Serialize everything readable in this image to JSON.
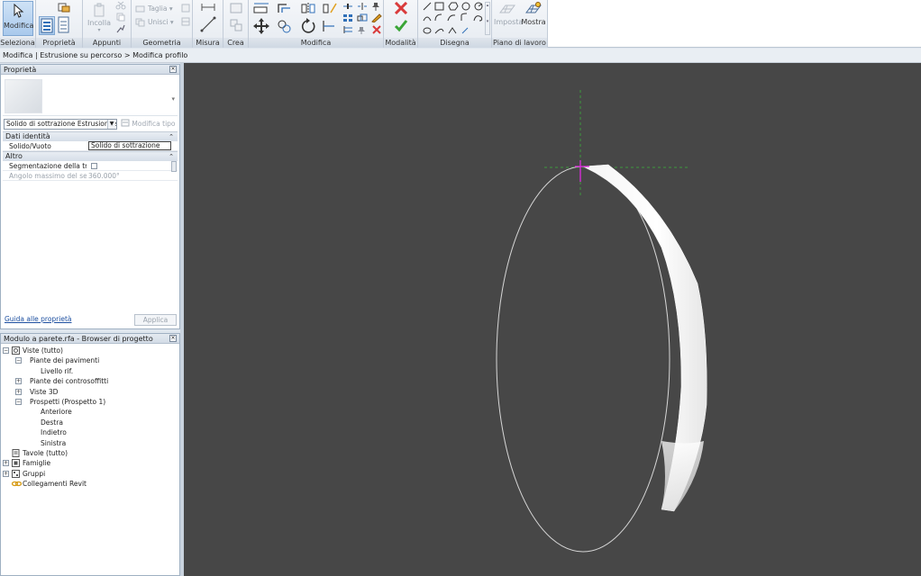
{
  "ribbon": {
    "panels": [
      {
        "id": "seleziona",
        "label": "Seleziona"
      },
      {
        "id": "proprieta",
        "label": "Proprietà"
      },
      {
        "id": "appunti",
        "label": "Appunti"
      },
      {
        "id": "geometria",
        "label": "Geometria"
      },
      {
        "id": "misura",
        "label": "Misura"
      },
      {
        "id": "crea",
        "label": "Crea"
      },
      {
        "id": "modifica",
        "label": "Modifica"
      },
      {
        "id": "modalita",
        "label": "Modalità"
      },
      {
        "id": "disegna",
        "label": "Disegna"
      },
      {
        "id": "piano",
        "label": "Piano di lavoro"
      }
    ],
    "buttons": {
      "modifica": "Modifica",
      "incolla": "Incolla",
      "taglia": "Taglia",
      "unisci": "Unisci",
      "imposta": "Imposta",
      "mostra": "Mostra"
    },
    "colors": {
      "finish": "#d93a3a",
      "ok": "#3aa536",
      "accent": "#2f6fb8"
    }
  },
  "breadcrumb": "Modifica | Estrusione su percorso > Modifica profilo",
  "properties": {
    "title": "Proprietà",
    "type_selector": "Solido di sottrazione Estrusione su",
    "edit_type": "Modifica tipo",
    "groups": [
      {
        "name": "Dati identità",
        "rows": [
          {
            "key": "Solido/Vuoto",
            "value": "Solido di sottrazione"
          }
        ]
      },
      {
        "name": "Altro",
        "rows": [
          {
            "key": "Segmentazione della tra...",
            "value": ""
          },
          {
            "key": "Angolo massimo del se...",
            "value": "360.000°"
          }
        ]
      }
    ],
    "help_link": "Guida alle proprietà",
    "apply": "Applica"
  },
  "browser": {
    "title": "Modulo a parete.rfa - Browser di progetto",
    "nodes": [
      {
        "label": "Viste (tutto)",
        "level": 0,
        "exp": "−",
        "icon": "views-icon"
      },
      {
        "label": "Piante dei pavimenti",
        "level": 1,
        "exp": "−"
      },
      {
        "label": "Livello rif.",
        "level": 2,
        "exp": ""
      },
      {
        "label": "Piante dei controsoffitti",
        "level": 1,
        "exp": "+"
      },
      {
        "label": "Viste 3D",
        "level": 1,
        "exp": "+"
      },
      {
        "label": "Prospetti (Prospetto 1)",
        "level": 1,
        "exp": "−"
      },
      {
        "label": "Anteriore",
        "level": 2,
        "exp": ""
      },
      {
        "label": "Destra",
        "level": 2,
        "exp": ""
      },
      {
        "label": "Indietro",
        "level": 2,
        "exp": ""
      },
      {
        "label": "Sinistra",
        "level": 2,
        "exp": ""
      },
      {
        "label": "Tavole (tutto)",
        "level": 0,
        "exp": "",
        "icon": "sheets-icon"
      },
      {
        "label": "Famiglie",
        "level": 0,
        "exp": "+",
        "icon": "families-icon"
      },
      {
        "label": "Gruppi",
        "level": 0,
        "exp": "+",
        "icon": "groups-icon"
      },
      {
        "label": "Collegamenti Revit",
        "level": 0,
        "exp": "",
        "icon": "revit-links-icon"
      }
    ]
  },
  "viewport": {
    "background": "#474747"
  }
}
